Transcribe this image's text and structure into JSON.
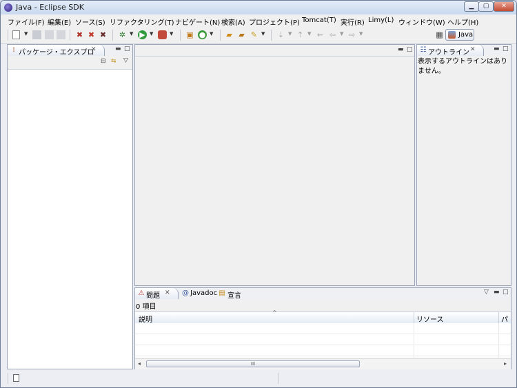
{
  "window": {
    "title": "Java - Eclipse SDK",
    "min_label": "▁",
    "max_label": "▢",
    "close_label": "✕"
  },
  "menu": [
    "ファイル(F)",
    "編集(E)",
    "ソース(S)",
    "リファクタリング(T)",
    "ナビゲート(N)",
    "検索(A)",
    "プロジェクト(P)",
    "Tomcat(T)",
    "実行(R)",
    "Limy(L)",
    "ウィンドウ(W)",
    "ヘルプ(H)"
  ],
  "perspective": {
    "label": "Java"
  },
  "package_explorer": {
    "tab_label": "パッケージ・エクスプロ"
  },
  "outline": {
    "tab_label": "アウトライン",
    "message": "表示するアウトラインはありません。"
  },
  "bottom": {
    "tabs": [
      "問題",
      "Javadoc",
      "宣言"
    ],
    "count_text": "0 項目",
    "columns": [
      "説明",
      "リソース",
      "パ"
    ]
  },
  "scroll": {
    "thumb_label": "III"
  },
  "colors": {
    "accent": "#cfe3f7",
    "border": "#9aa5b8"
  }
}
